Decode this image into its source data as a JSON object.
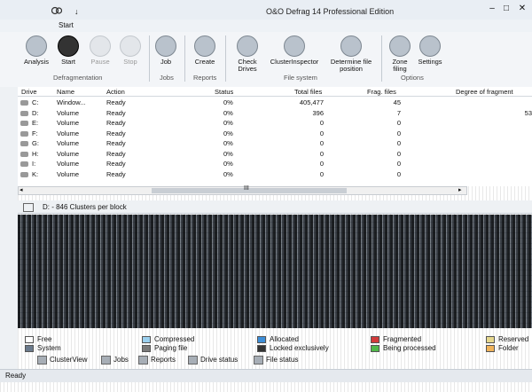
{
  "window": {
    "title": "O&O Defrag 14 Professional Edition",
    "quick_access": "↓",
    "controls": [
      "–",
      "□",
      "✕"
    ]
  },
  "menu_tab": "Start",
  "ribbon": {
    "buttons": [
      {
        "label": "Analysis",
        "icon": "analysis-icon"
      },
      {
        "label": "Start",
        "icon": "start-icon"
      },
      {
        "label": "Pause",
        "icon": "pause-icon"
      },
      {
        "label": "Stop",
        "icon": "stop-icon"
      },
      {
        "label": "Job",
        "icon": "job-icon"
      },
      {
        "label": "Create",
        "icon": "create-report-icon"
      },
      {
        "label": "Check Drives",
        "icon": "check-drives-icon"
      },
      {
        "label": "ClusterInspector",
        "icon": "cluster-inspector-icon"
      },
      {
        "label": "Determine file position",
        "icon": "file-position-icon"
      },
      {
        "label": "Zone filing",
        "icon": "zone-filing-icon"
      },
      {
        "label": "Settings",
        "icon": "settings-icon"
      }
    ],
    "groups": [
      "Defragmentation",
      "Jobs",
      "Reports",
      "File system",
      "Options"
    ]
  },
  "drive_list": {
    "columns": [
      "Drive",
      "Name",
      "Action",
      "Status",
      "Total files",
      "Frag. files",
      "Degree of fragment"
    ],
    "rows": [
      {
        "drive": "C:",
        "name": "Window...",
        "action": "Ready",
        "status": "0%",
        "total": "405,477",
        "frag": "45",
        "degree": ""
      },
      {
        "drive": "D:",
        "name": "Volume",
        "action": "Ready",
        "status": "0%",
        "total": "396",
        "frag": "7",
        "degree": "53"
      },
      {
        "drive": "E:",
        "name": "Volume",
        "action": "Ready",
        "status": "0%",
        "total": "0",
        "frag": "0",
        "degree": ""
      },
      {
        "drive": "F:",
        "name": "Volume",
        "action": "Ready",
        "status": "0%",
        "total": "0",
        "frag": "0",
        "degree": ""
      },
      {
        "drive": "G:",
        "name": "Volume",
        "action": "Ready",
        "status": "0%",
        "total": "0",
        "frag": "0",
        "degree": ""
      },
      {
        "drive": "H:",
        "name": "Volume",
        "action": "Ready",
        "status": "0%",
        "total": "0",
        "frag": "0",
        "degree": ""
      },
      {
        "drive": "I:",
        "name": "Volume",
        "action": "Ready",
        "status": "0%",
        "total": "0",
        "frag": "0",
        "degree": ""
      },
      {
        "drive": "K:",
        "name": "Volume",
        "action": "Ready",
        "status": "0%",
        "total": "0",
        "frag": "0",
        "degree": ""
      }
    ]
  },
  "scroll_marker": "III",
  "cluster_view": {
    "caption": "D: - 846 Clusters per block"
  },
  "legend": [
    {
      "label": "Free",
      "color": "#ffffff"
    },
    {
      "label": "System",
      "color": "#6b7a8c"
    },
    {
      "label": "Compressed",
      "color": "#9bd0ef"
    },
    {
      "label": "Paging file",
      "color": "#7a7a7a"
    },
    {
      "label": "Allocated",
      "color": "#3d8ed8"
    },
    {
      "label": "Locked exclusively",
      "color": "#333333"
    },
    {
      "label": "Fragmented",
      "color": "#d23b3b"
    },
    {
      "label": "Being processed",
      "color": "#4fb84a"
    },
    {
      "label": "Reserved",
      "color": "#e6d88e"
    },
    {
      "label": "Folder",
      "color": "#f0b35a"
    }
  ],
  "bottom_tabs": [
    {
      "label": "ClusterView",
      "icon": "clusterview-icon"
    },
    {
      "label": "Jobs",
      "icon": "jobs-icon"
    },
    {
      "label": "Reports",
      "icon": "reports-icon"
    },
    {
      "label": "Drive status",
      "icon": "drive-status-icon"
    },
    {
      "label": "File status",
      "icon": "file-status-icon"
    }
  ],
  "status_text": "Ready"
}
